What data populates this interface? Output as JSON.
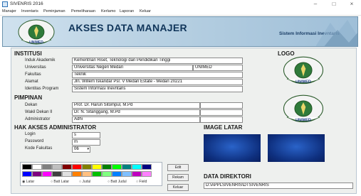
{
  "window": {
    "title": "SIVENRIS 2016",
    "controls": [
      "–",
      "□",
      "×"
    ]
  },
  "menu": [
    "Manajer",
    "Inventaris",
    "Peminjaman",
    "Pemeliharaan",
    "Kerlamo",
    "Laporan",
    "Keluar"
  ],
  "banner": {
    "title": "AKSES DATA MANAJER",
    "subtitle": "Sistem Informasi Inevntaris",
    "logo_text": "UNIMED"
  },
  "institusi": {
    "heading": "INSTITUSI",
    "rows": [
      {
        "label": "Induk Akademik",
        "value": "Kementrian Riset, Teknologi dan Pendidikan Tinggi"
      },
      {
        "label": "Universitas",
        "value": "Universitas Negeri Medan",
        "extra": "UNIMED"
      },
      {
        "label": "Fakultas",
        "value": "Teknik"
      },
      {
        "label": "Alamat",
        "value": "Jln. Willem Iskandar Psr. V Medan Estate - Medan 20221"
      },
      {
        "label": "Identitas Program",
        "value": "Sistem Informasi Inevntaris"
      }
    ]
  },
  "logo": {
    "heading": "LOGO",
    "text": "UNIMED"
  },
  "pimpinan": {
    "heading": "PIMPINAN",
    "rows": [
      {
        "label": "Dekan",
        "value": "Prof. Dr. Harun Sitompul, M.Pd"
      },
      {
        "label": "Wakil Dekan II",
        "value": "Dr. N. Sitanggang, M.Pd"
      },
      {
        "label": "Administrator",
        "value": "Adhi"
      }
    ]
  },
  "hak_akses": {
    "heading": "HAK AKSES ADMINISTRATOR",
    "login_label": "Login",
    "login_value": "s",
    "password_label": "Password",
    "password_value": "m",
    "kode_label": "Kode Fakultas",
    "kode_value": "06"
  },
  "image_latar": {
    "heading": "IMAGE LATAR"
  },
  "data_direktori": {
    "heading": "DATA DIREKTORI",
    "value": "D:\\APPLSIVENRIS\\DTSIVENRIS"
  },
  "buttons": {
    "edit": "Edit",
    "rekam": "Rekam",
    "keluar": "Keluar"
  },
  "palette": [
    "#000000",
    "#ffffff",
    "#7f7f7f",
    "#c0c0c0",
    "#800000",
    "#ff0000",
    "#808000",
    "#ffff00",
    "#008000",
    "#00ff00",
    "#008080",
    "#00ffff",
    "#000080",
    "#0000ff",
    "#800080",
    "#ff00ff",
    "#404040",
    "#e0e0e0",
    "#ff8000",
    "#ffc080",
    "#00c000",
    "#80ff80",
    "#0080ff",
    "#80c0ff",
    "#c000c0",
    "#ff80ff"
  ],
  "radio_options": [
    "Latar",
    "Batt Latar",
    "Judul",
    "Batt Judul",
    "Field"
  ]
}
